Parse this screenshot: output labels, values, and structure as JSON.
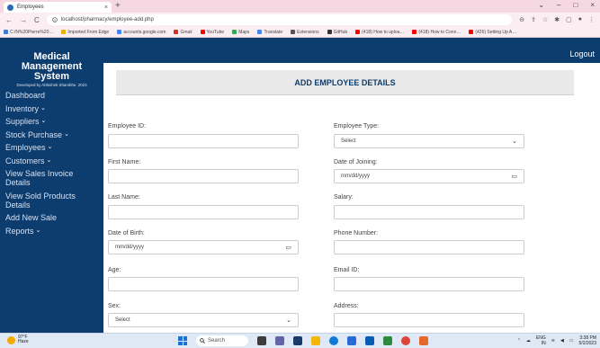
{
  "browser": {
    "tab_title": "Employees",
    "tab_close": "×",
    "new_tab": "+",
    "window_controls": [
      "⌄",
      "–",
      "□",
      "×"
    ],
    "back": "←",
    "forward": "→",
    "reload": "C",
    "url": "localhost/pharmacy/employee-add.php",
    "bookmarks": [
      {
        "label": "C:/N%20Pierre%20…",
        "color": "#3a7bd5"
      },
      {
        "label": "Imported From Edge",
        "color": "#e8b400"
      },
      {
        "label": "accounts.google.com",
        "color": "#4285f4"
      },
      {
        "label": "Gmail",
        "color": "#d93025"
      },
      {
        "label": "YouTube",
        "color": "#ff0000"
      },
      {
        "label": "Maps",
        "color": "#34a853"
      },
      {
        "label": "Translate",
        "color": "#4285f4"
      },
      {
        "label": "Extensions",
        "color": "#555555"
      },
      {
        "label": "GitHub",
        "color": "#333333"
      },
      {
        "label": "(418) How to uploa…",
        "color": "#ff0000"
      },
      {
        "label": "(418) How to Conn…",
        "color": "#ff0000"
      },
      {
        "label": "(426) Setting Up A…",
        "color": "#ff0000"
      }
    ]
  },
  "app": {
    "brand_line1": "Medical",
    "brand_line2": "Management",
    "brand_line3": "System",
    "developer": "Developed by Abhishek Shambhe, 2023",
    "logout": "Logout"
  },
  "sidebar": {
    "items": [
      {
        "label": "Dashboard",
        "dropdown": false
      },
      {
        "label": "Inventory",
        "dropdown": true
      },
      {
        "label": "Suppliers",
        "dropdown": true
      },
      {
        "label": "Stock Purchase",
        "dropdown": true
      },
      {
        "label": "Employees",
        "dropdown": true
      },
      {
        "label": "Customers",
        "dropdown": true
      },
      {
        "label": "View Sales Invoice Details",
        "dropdown": false
      },
      {
        "label": "View Sold Products Details",
        "dropdown": false
      },
      {
        "label": "Add New Sale",
        "dropdown": false
      },
      {
        "label": "Reports",
        "dropdown": true
      }
    ],
    "chevron": "⌄"
  },
  "form": {
    "title": "ADD EMPLOYEE DETAILS",
    "employee_id": {
      "label": "Employee ID:",
      "value": ""
    },
    "employee_type": {
      "label": "Employee Type:",
      "value": "Select"
    },
    "first_name": {
      "label": "First Name:",
      "value": ""
    },
    "date_of_joining": {
      "label": "Date of Joining:",
      "value": "mm/dd/yyyy"
    },
    "last_name": {
      "label": "Last Name:",
      "value": ""
    },
    "salary": {
      "label": "Salary:",
      "value": ""
    },
    "date_of_birth": {
      "label": "Date of Birth:",
      "value": "mm/dd/yyyy"
    },
    "phone_number": {
      "label": "Phone Number:",
      "value": ""
    },
    "age": {
      "label": "Age:",
      "value": ""
    },
    "email_id": {
      "label": "Email ID:",
      "value": ""
    },
    "sex": {
      "label": "Sex:",
      "value": "Select"
    },
    "address": {
      "label": "Address:",
      "value": ""
    }
  },
  "taskbar": {
    "temp": "97°F",
    "weather": "Haze",
    "search": "Search",
    "lang": "ENG",
    "region": "IN",
    "time": "3:38 PM",
    "date": "5/2/2023"
  }
}
